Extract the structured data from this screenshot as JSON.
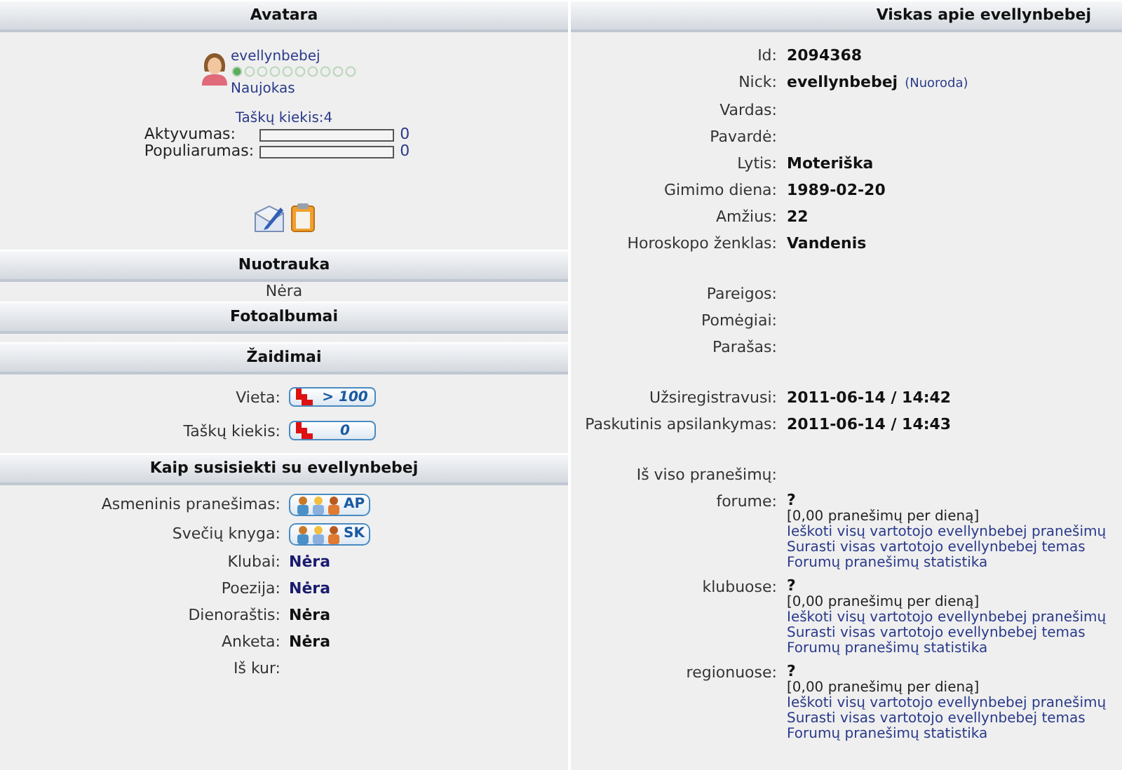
{
  "left": {
    "avatar": {
      "title": "Avatara",
      "nick": "evellynbebej",
      "rank_meter": {
        "level": 0.05
      },
      "rank": "Naujokas",
      "points": "Taškų kiekis:4",
      "meters": [
        {
          "label": "Aktyvumas:",
          "level": 0,
          "reading": "0"
        },
        {
          "label": "Populiarumas:",
          "level": 0,
          "reading": "0"
        }
      ]
    },
    "photo": {
      "title": "Nuotrauka",
      "text": "Nėra"
    },
    "albums": {
      "title": "Fotoalbumai"
    },
    "games": {
      "title": "Žaidimai",
      "rows": [
        {
          "label": "Vieta:",
          "value": "> 100"
        },
        {
          "label": "Taškų kiekis:",
          "value": "0"
        }
      ]
    },
    "contact": {
      "title": "Kaip susisiekti su evellynbebej",
      "rows": [
        {
          "label": "Asmeninis pranešimas:",
          "kind": "badge",
          "value": "AP"
        },
        {
          "label": "Svečių knyga:",
          "kind": "badge",
          "value": "SK"
        },
        {
          "label": "Klubai:",
          "kind": "link",
          "value": "Nėra"
        },
        {
          "label": "Poezija:",
          "kind": "link",
          "value": "Nėra"
        },
        {
          "label": "Dienoraštis:",
          "kind": "text",
          "value": "Nėra"
        },
        {
          "label": "Anketa:",
          "kind": "text",
          "value": "Nėra"
        },
        {
          "label": "Iš kur:",
          "kind": "text"
        }
      ]
    }
  },
  "right": {
    "title": "Viskas apie evellynbebej",
    "groups": [
      [
        {
          "label": "Id:",
          "value": "2094368"
        },
        {
          "label": "Nick:",
          "value": "evellynbebej",
          "link": "(Nuoroda)"
        },
        {
          "label": "Vardas:"
        },
        {
          "label": "Pavardė:"
        },
        {
          "label": "Lytis:",
          "value": "Moteriška"
        },
        {
          "label": "Gimimo diena:",
          "value": "1989-02-20"
        },
        {
          "label": "Amžius:",
          "value": "22"
        },
        {
          "label": "Horoskopo ženklas:",
          "value": "Vandenis"
        }
      ],
      [
        {
          "label": "Pareigos:"
        },
        {
          "label": "Pomėgiai:"
        },
        {
          "label": "Parašas:"
        }
      ],
      [
        {
          "label": "Užsiregistravusi:",
          "value": "2011-06-14 / 14:42"
        },
        {
          "label": "Paskutinis apsilankymas:",
          "value": "2011-06-14 / 14:43"
        }
      ]
    ],
    "stats": {
      "title": "Iš viso pranešimų:",
      "rows": [
        {
          "label": "forume:",
          "value": "?",
          "rate": "[0,00 pranešimų per dieną]",
          "links": [
            "Ieškoti visų vartotojo evellynbebej pranešimų",
            "Surasti visas vartotojo evellynbebej temas",
            "Forumų pranešimų statistika"
          ]
        },
        {
          "label": "klubuose:",
          "value": "?",
          "rate": "[0,00 pranešimų per dieną]",
          "links": [
            "Ieškoti visų vartotojo evellynbebej pranešimų",
            "Surasti visas vartotojo evellynbebej temas",
            "Forumų pranešimų statistika"
          ]
        },
        {
          "label": "regionuose:",
          "value": "?",
          "rate": "[0,00 pranešimų per dieną]",
          "links": [
            "Ieškoti visų vartotojo evellynbebej pranešimų",
            "Surasti visas vartotojo evellynbebej temas",
            "Forumų pranešimų statistika"
          ]
        }
      ]
    }
  }
}
